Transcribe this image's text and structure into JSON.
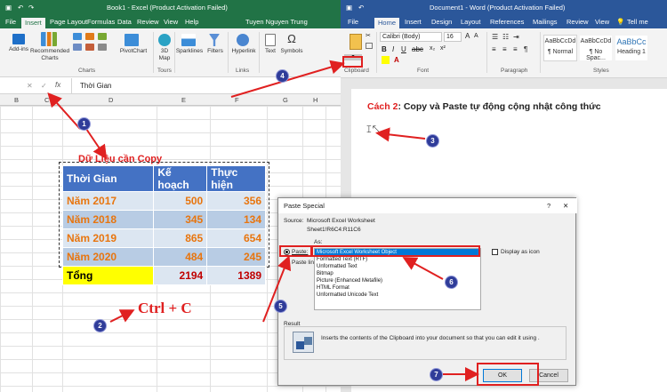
{
  "excel": {
    "title": "Book1 - Excel (Product Activation Failed)",
    "tabs": [
      "File",
      "Insert",
      "Page Layout",
      "Formulas",
      "Data",
      "Review",
      "View",
      "Help",
      "Tuyen Nguyen Trung"
    ],
    "active_tab": "Insert",
    "ribbon": {
      "addins": "Add-ins",
      "recommended_charts": "Recommended Charts",
      "pivotchart": "PivotChart",
      "map3d": "3D Map",
      "sparklines": "Sparklines",
      "filters": "Filters",
      "hyperlink": "Hyperlink",
      "text": "Text",
      "symbols": "Symbols",
      "group_charts": "Charts",
      "group_links": "Links",
      "group_tours": "Tours"
    },
    "formula_bar": {
      "fx": "fx",
      "value": "Thời Gian"
    },
    "columns": [
      "B",
      "C",
      "D",
      "E",
      "F",
      "G",
      "H"
    ],
    "table": {
      "caption": "Dữ Liệu cần Copy",
      "headers": [
        "Thời Gian",
        "Kế hoạch",
        "Thực hiện"
      ],
      "rows": [
        [
          "Năm 2017",
          "500",
          "356"
        ],
        [
          "Năm 2018",
          "345",
          "134"
        ],
        [
          "Năm 2019",
          "865",
          "654"
        ],
        [
          "Năm 2020",
          "484",
          "245"
        ]
      ],
      "total": [
        "Tổng",
        "2194",
        "1389"
      ]
    },
    "shortcut": "Ctrl + C"
  },
  "word": {
    "title": "Document1 - Word (Product Activation Failed)",
    "tabs": [
      "File",
      "Home",
      "Insert",
      "Design",
      "Layout",
      "References",
      "Mailings",
      "Review",
      "View",
      "Tell me"
    ],
    "active_tab": "Home",
    "font_name": "Calibri (Body)",
    "font_size": "16",
    "groups": [
      "Clipboard",
      "Font",
      "Paragraph",
      "Styles"
    ],
    "styles": [
      {
        "sample": "AaBbCcDd",
        "name": "¶ Normal"
      },
      {
        "sample": "AaBbCcDd",
        "name": "¶ No Spac..."
      },
      {
        "sample": "AaBbCc",
        "name": "Heading 1"
      }
    ],
    "heading_prefix": "Cách 2",
    "heading_rest": ": Copy và Paste tự động cộng nhật công thức"
  },
  "dialog": {
    "title": "Paste Special",
    "close": "✕",
    "help": "?",
    "source_label": "Source:",
    "source_value": "Microsoft Excel Worksheet",
    "source_ref": "Sheet1!R6C4:R11C6",
    "as_label": "As:",
    "paste_label": "Paste:",
    "paste_link_label": "Paste link:",
    "options": [
      "Microsoft Excel Worksheet Object",
      "Formatted Text (RTF)",
      "Unformatted Text",
      "Bitmap",
      "Picture (Enhanced Metafile)",
      "HTML Format",
      "Unformatted Unicode Text"
    ],
    "display_as_icon": "Display as icon",
    "result_label": "Result",
    "result_text": "Inserts the contents of the Clipboard into your document so that you can edit it using .",
    "ok": "OK",
    "cancel": "Cancel"
  },
  "markers": [
    "1",
    "2",
    "3",
    "4",
    "5",
    "6",
    "7"
  ],
  "colors": {
    "excel_green": "#217346",
    "word_blue": "#2b579a",
    "annotation_red": "#e02020",
    "marker_blue": "#2f3c99"
  }
}
